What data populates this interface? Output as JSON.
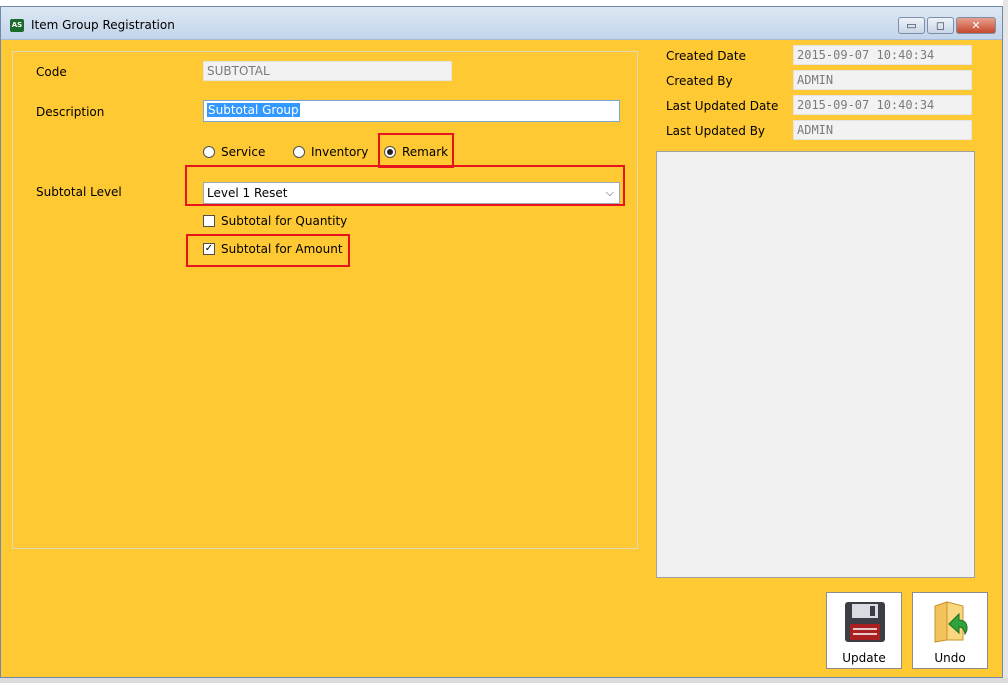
{
  "window": {
    "app_icon": "AS",
    "title": "Item Group Registration",
    "minimize_icon": "minimize-icon",
    "maximize_icon": "maximize-icon",
    "close_icon": "close-icon"
  },
  "form": {
    "code_label": "Code",
    "code_value": "SUBTOTAL",
    "description_label": "Description",
    "description_value": "Subtotal Group",
    "type_options": [
      "Service",
      "Inventory",
      "Remark"
    ],
    "type_selected": "Remark",
    "subtotal_level_label": "Subtotal Level",
    "subtotal_level_value": "Level 1 Reset",
    "subtotal_quantity_label": "Subtotal for Quantity",
    "subtotal_quantity_checked": false,
    "subtotal_amount_label": "Subtotal for Amount",
    "subtotal_amount_checked": true
  },
  "audit": {
    "created_date_label": "Created Date",
    "created_date_value": "2015-09-07 10:40:34",
    "created_by_label": "Created By",
    "created_by_value": "ADMIN",
    "last_updated_date_label": "Last Updated Date",
    "last_updated_date_value": "2015-09-07 10:40:34",
    "last_updated_by_label": "Last Updated By",
    "last_updated_by_value": "ADMIN"
  },
  "toolbar": {
    "update_label": "Update",
    "update_icon": "floppy-disk-icon",
    "undo_label": "Undo",
    "undo_icon": "folder-undo-icon"
  },
  "colors": {
    "window_background": "#ffc933",
    "highlight_border": "#e8141c",
    "selection": "#3399ff"
  }
}
